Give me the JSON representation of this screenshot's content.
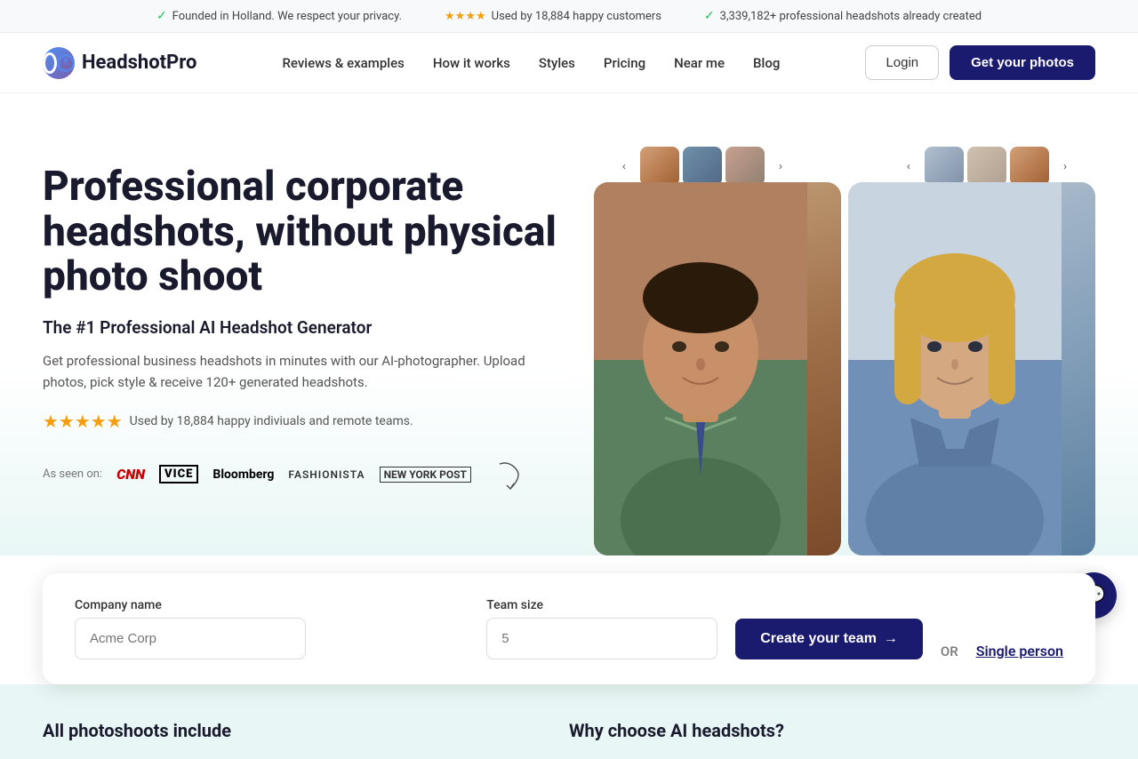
{
  "topbar": {
    "items": [
      {
        "icon": "check",
        "text": "Founded in Holland. We respect your privacy."
      },
      {
        "stars": "★★★★",
        "text": "Used by 18,884 happy customers"
      },
      {
        "icon": "check",
        "text": "3,339,182+ professional headshots already created"
      }
    ]
  },
  "logo": {
    "text": "HeadshotPro"
  },
  "nav": {
    "links": [
      {
        "label": "Reviews & examples",
        "href": "#"
      },
      {
        "label": "How it works",
        "href": "#"
      },
      {
        "label": "Styles",
        "href": "#"
      },
      {
        "label": "Pricing",
        "href": "#"
      },
      {
        "label": "Near me",
        "href": "#"
      },
      {
        "label": "Blog",
        "href": "#"
      }
    ],
    "login_label": "Login",
    "cta_label": "Get your photos"
  },
  "hero": {
    "title": "Professional corporate headshots, without physical photo shoot",
    "subtitle": "The #1 Professional AI Headshot Generator",
    "description": "Get professional business headshots in minutes with our AI-photographer. Upload photos, pick style & receive 120+ generated headshots.",
    "rating": {
      "stars": "★★★★★",
      "text": "Used by 18,884 happy indiviuals and remote teams."
    },
    "as_seen_label": "As seen on:",
    "brands": [
      {
        "name": "CNN",
        "style": "cnn"
      },
      {
        "name": "VICE",
        "style": "vice"
      },
      {
        "name": "Bloomberg",
        "style": "bloomberg"
      },
      {
        "name": "Fashionista",
        "style": "fashionista"
      },
      {
        "name": "New York Post",
        "style": "nyp"
      }
    ]
  },
  "form": {
    "company_label": "Company name",
    "company_placeholder": "Acme Corp",
    "team_label": "Team size",
    "team_placeholder": "5",
    "cta_label": "Create your team",
    "cta_arrow": "→",
    "or_text": "OR",
    "single_label": "Single person"
  },
  "bottom": {
    "col1_title": "All photoshoots include",
    "col2_title": "Why choose AI headshots?"
  },
  "chat": {
    "icon": "💬"
  }
}
